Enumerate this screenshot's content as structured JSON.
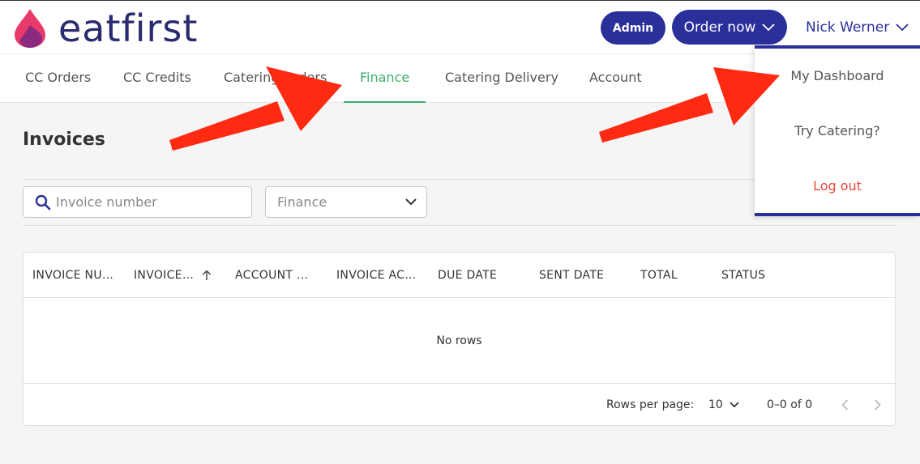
{
  "app": {
    "brand": "eatfirst",
    "colors": {
      "brand_navy": "#2a2f9a",
      "active_green": "#38b06a",
      "logout_red": "#e8473f",
      "annotation_red": "#ff2a12"
    }
  },
  "header": {
    "admin_label": "Admin",
    "order_label": "Order now",
    "user_name": "Nick Werner"
  },
  "nav": {
    "items": [
      {
        "label": "CC Orders"
      },
      {
        "label": "CC Credits"
      },
      {
        "label": "Catering Orders"
      },
      {
        "label": "Finance",
        "active": true
      },
      {
        "label": "Catering Delivery"
      },
      {
        "label": "Account"
      }
    ]
  },
  "user_dropdown": {
    "items": [
      {
        "label": "My Dashboard"
      },
      {
        "label": "Try Catering?"
      },
      {
        "label": "Log out"
      }
    ]
  },
  "main": {
    "title": "Invoices",
    "search_placeholder": "Invoice number",
    "filter_value": "Finance",
    "columns": [
      {
        "label": "INVOICE NUMBER"
      },
      {
        "label": "INVOICE DATE",
        "sorted": "asc"
      },
      {
        "label": "ACCOUNT LABEL"
      },
      {
        "label": "INVOICE ACCOUNT"
      },
      {
        "label": "DUE DATE"
      },
      {
        "label": "SENT DATE"
      },
      {
        "label": "TOTAL"
      },
      {
        "label": "STATUS"
      }
    ],
    "empty_text": "No rows",
    "footer": {
      "rows_per_page_label": "Rows per page:",
      "rows_per_page_value": "10",
      "range_text": "0–0 of 0"
    }
  },
  "icons": {
    "search": "search-icon",
    "chevron": "chevron-down-icon",
    "sort": "arrow-up-icon",
    "prev": "chevron-left-icon",
    "next": "chevron-right-icon"
  }
}
